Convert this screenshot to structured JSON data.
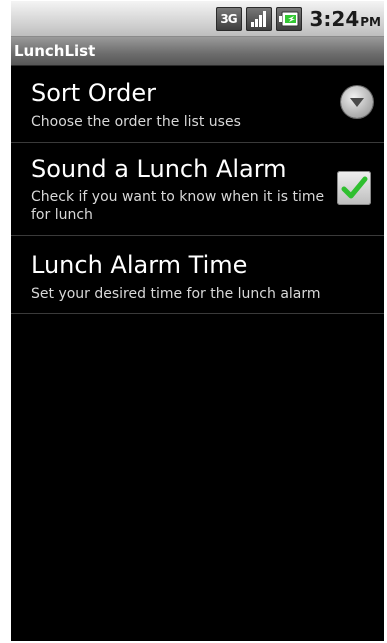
{
  "status_bar": {
    "network": "3G",
    "time": "3:24",
    "ampm": "PM",
    "icons": [
      "3g-icon",
      "signal-bars-icon",
      "battery-charging-icon"
    ]
  },
  "app_bar": {
    "title": "LunchList"
  },
  "preferences": [
    {
      "title": "Sort Order",
      "summary": "Choose the order the list uses",
      "widget": "dropdown-arrow-icon"
    },
    {
      "title": "Sound a Lunch Alarm",
      "summary": "Check if you want to know when it is time for lunch",
      "widget": "checkbox",
      "checked": true
    },
    {
      "title": "Lunch Alarm Time",
      "summary": "Set your desired time for the lunch alarm",
      "widget": "none"
    }
  ],
  "colors": {
    "background": "#000000",
    "check_green": "#2fbf2f",
    "title_bar": "#6c6c6c"
  }
}
